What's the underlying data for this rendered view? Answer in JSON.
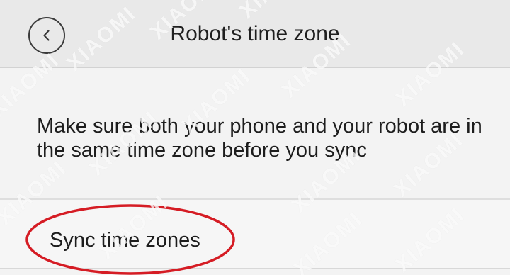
{
  "header": {
    "title": "Robot's time zone",
    "back_icon": "chevron-left-icon"
  },
  "info": {
    "text": "Make sure both your phone and your robot are in the same time zone before you sync"
  },
  "sync": {
    "label": "Sync time zones"
  },
  "annotation": {
    "color": "#d51c24"
  },
  "watermark": {
    "text": "XIAOMI"
  }
}
